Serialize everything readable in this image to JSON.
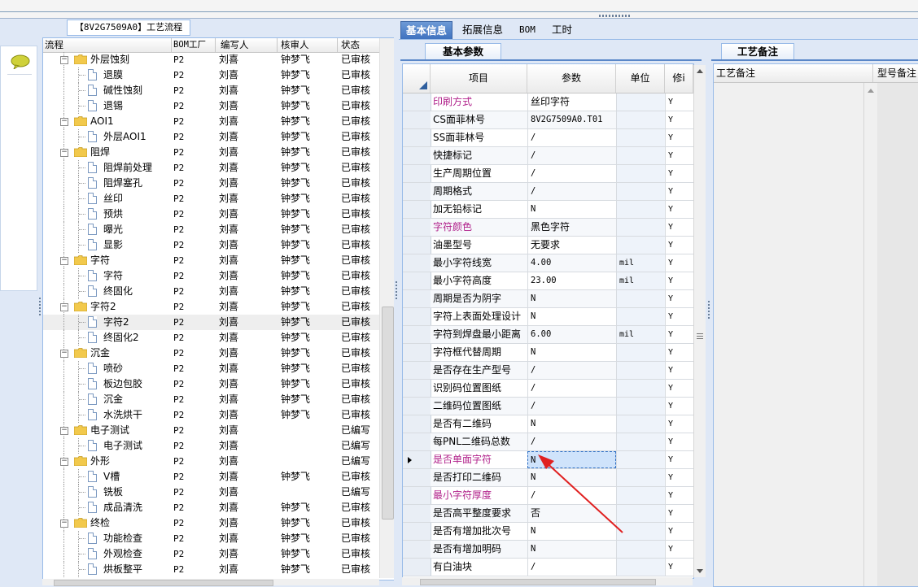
{
  "tree": {
    "title": "【8V2G7509A0】工艺流程",
    "headers": {
      "flow": "流程",
      "bom": "BOM工厂",
      "writer": "编写人",
      "auditor": "核审人",
      "status": "状态"
    },
    "rows": [
      {
        "level": 0,
        "label": "外层蚀刻",
        "bom": "P2",
        "writer": "刘喜",
        "auditor": "钟梦飞",
        "status": "已审核"
      },
      {
        "level": 1,
        "label": "退膜",
        "bom": "P2",
        "writer": "刘喜",
        "auditor": "钟梦飞",
        "status": "已审核"
      },
      {
        "level": 1,
        "label": "碱性蚀刻",
        "bom": "P2",
        "writer": "刘喜",
        "auditor": "钟梦飞",
        "status": "已审核"
      },
      {
        "level": 1,
        "label": "退锡",
        "bom": "P2",
        "writer": "刘喜",
        "auditor": "钟梦飞",
        "status": "已审核"
      },
      {
        "level": 0,
        "label": "AOI1",
        "bom": "P2",
        "writer": "刘喜",
        "auditor": "钟梦飞",
        "status": "已审核"
      },
      {
        "level": 1,
        "label": "外层AOI1",
        "bom": "P2",
        "writer": "刘喜",
        "auditor": "钟梦飞",
        "status": "已审核"
      },
      {
        "level": 0,
        "label": "阻焊",
        "bom": "P2",
        "writer": "刘喜",
        "auditor": "钟梦飞",
        "status": "已审核"
      },
      {
        "level": 1,
        "label": "阻焊前处理",
        "bom": "P2",
        "writer": "刘喜",
        "auditor": "钟梦飞",
        "status": "已审核"
      },
      {
        "level": 1,
        "label": "阻焊塞孔",
        "bom": "P2",
        "writer": "刘喜",
        "auditor": "钟梦飞",
        "status": "已审核"
      },
      {
        "level": 1,
        "label": "丝印",
        "bom": "P2",
        "writer": "刘喜",
        "auditor": "钟梦飞",
        "status": "已审核"
      },
      {
        "level": 1,
        "label": "预烘",
        "bom": "P2",
        "writer": "刘喜",
        "auditor": "钟梦飞",
        "status": "已审核"
      },
      {
        "level": 1,
        "label": "曝光",
        "bom": "P2",
        "writer": "刘喜",
        "auditor": "钟梦飞",
        "status": "已审核"
      },
      {
        "level": 1,
        "label": "显影",
        "bom": "P2",
        "writer": "刘喜",
        "auditor": "钟梦飞",
        "status": "已审核"
      },
      {
        "level": 0,
        "label": "字符",
        "bom": "P2",
        "writer": "刘喜",
        "auditor": "钟梦飞",
        "status": "已审核"
      },
      {
        "level": 1,
        "label": "字符",
        "bom": "P2",
        "writer": "刘喜",
        "auditor": "钟梦飞",
        "status": "已审核"
      },
      {
        "level": 1,
        "label": "终固化",
        "bom": "P2",
        "writer": "刘喜",
        "auditor": "钟梦飞",
        "status": "已审核"
      },
      {
        "level": 0,
        "label": "字符2",
        "bom": "P2",
        "writer": "刘喜",
        "auditor": "钟梦飞",
        "status": "已审核"
      },
      {
        "level": 1,
        "label": "字符2",
        "bom": "P2",
        "writer": "刘喜",
        "auditor": "钟梦飞",
        "status": "已审核",
        "selected": true
      },
      {
        "level": 1,
        "label": "终固化2",
        "bom": "P2",
        "writer": "刘喜",
        "auditor": "钟梦飞",
        "status": "已审核"
      },
      {
        "level": 0,
        "label": "沉金",
        "bom": "P2",
        "writer": "刘喜",
        "auditor": "钟梦飞",
        "status": "已审核"
      },
      {
        "level": 1,
        "label": "喷砂",
        "bom": "P2",
        "writer": "刘喜",
        "auditor": "钟梦飞",
        "status": "已审核"
      },
      {
        "level": 1,
        "label": "板边包胶",
        "bom": "P2",
        "writer": "刘喜",
        "auditor": "钟梦飞",
        "status": "已审核"
      },
      {
        "level": 1,
        "label": "沉金",
        "bom": "P2",
        "writer": "刘喜",
        "auditor": "钟梦飞",
        "status": "已审核"
      },
      {
        "level": 1,
        "label": "水洗烘干",
        "bom": "P2",
        "writer": "刘喜",
        "auditor": "钟梦飞",
        "status": "已审核"
      },
      {
        "level": 0,
        "label": "电子测试",
        "bom": "P2",
        "writer": "刘喜",
        "auditor": "",
        "status": "已编写"
      },
      {
        "level": 1,
        "label": "电子测试",
        "bom": "P2",
        "writer": "刘喜",
        "auditor": "",
        "status": "已编写"
      },
      {
        "level": 0,
        "label": "外形",
        "bom": "P2",
        "writer": "刘喜",
        "auditor": "",
        "status": "已编写"
      },
      {
        "level": 1,
        "label": "V槽",
        "bom": "P2",
        "writer": "刘喜",
        "auditor": "钟梦飞",
        "status": "已审核"
      },
      {
        "level": 1,
        "label": "铣板",
        "bom": "P2",
        "writer": "刘喜",
        "auditor": "",
        "status": "已编写"
      },
      {
        "level": 1,
        "label": "成品清洗",
        "bom": "P2",
        "writer": "刘喜",
        "auditor": "钟梦飞",
        "status": "已审核"
      },
      {
        "level": 0,
        "label": "终检",
        "bom": "P2",
        "writer": "刘喜",
        "auditor": "钟梦飞",
        "status": "已审核"
      },
      {
        "level": 1,
        "label": "功能检查",
        "bom": "P2",
        "writer": "刘喜",
        "auditor": "钟梦飞",
        "status": "已审核"
      },
      {
        "level": 1,
        "label": "外观检查",
        "bom": "P2",
        "writer": "刘喜",
        "auditor": "钟梦飞",
        "status": "已审核"
      },
      {
        "level": 1,
        "label": "烘板整平",
        "bom": "P2",
        "writer": "刘喜",
        "auditor": "钟梦飞",
        "status": "已审核"
      }
    ]
  },
  "tabs": [
    "基本信息",
    "拓展信息",
    "BOM",
    "工时"
  ],
  "params": {
    "tab_label": "基本参数",
    "headers": {
      "item": "项目",
      "param": "参数",
      "unit": "单位",
      "mod": "修i"
    },
    "rows": [
      {
        "item": "印刷方式",
        "param": "丝印字符",
        "unit": "",
        "mod": "Y",
        "pink": true
      },
      {
        "item": "CS面菲林号",
        "param": "8V2G7509A0.T01",
        "unit": "",
        "mod": "Y"
      },
      {
        "item": "SS面菲林号",
        "param": "/",
        "unit": "",
        "mod": "Y"
      },
      {
        "item": "快捷标记",
        "param": "/",
        "unit": "",
        "mod": "Y"
      },
      {
        "item": "生产周期位置",
        "param": "/",
        "unit": "",
        "mod": "Y"
      },
      {
        "item": "周期格式",
        "param": "/",
        "unit": "",
        "mod": "Y"
      },
      {
        "item": "加无铅标记",
        "param": "N",
        "unit": "",
        "mod": "Y"
      },
      {
        "item": "字符颜色",
        "param": "黑色字符",
        "unit": "",
        "mod": "Y",
        "pink": true
      },
      {
        "item": "油墨型号",
        "param": "无要求",
        "unit": "",
        "mod": "Y"
      },
      {
        "item": "最小字符线宽",
        "param": "4.00",
        "unit": "mil",
        "mod": "Y"
      },
      {
        "item": "最小字符高度",
        "param": "23.00",
        "unit": "mil",
        "mod": "Y"
      },
      {
        "item": "周期是否为阴字",
        "param": "N",
        "unit": "",
        "mod": "Y"
      },
      {
        "item": "字符上表面处理设计",
        "param": "N",
        "unit": "",
        "mod": "Y"
      },
      {
        "item": "字符到焊盘最小距离",
        "param": "6.00",
        "unit": "mil",
        "mod": "Y"
      },
      {
        "item": "字符框代替周期",
        "param": "N",
        "unit": "",
        "mod": "Y"
      },
      {
        "item": "是否存在生产型号",
        "param": "/",
        "unit": "",
        "mod": "Y"
      },
      {
        "item": "识别码位置图纸",
        "param": "/",
        "unit": "",
        "mod": "Y"
      },
      {
        "item": "二维码位置图纸",
        "param": "/",
        "unit": "",
        "mod": "Y"
      },
      {
        "item": "是否有二维码",
        "param": "N",
        "unit": "",
        "mod": "Y"
      },
      {
        "item": "每PNL二维码总数",
        "param": "/",
        "unit": "",
        "mod": "Y"
      },
      {
        "item": "是否单面字符",
        "param": "N",
        "unit": "",
        "mod": "Y",
        "pink": true,
        "current": true
      },
      {
        "item": "是否打印二维码",
        "param": "N",
        "unit": "",
        "mod": "Y"
      },
      {
        "item": "最小字符厚度",
        "param": "/",
        "unit": "",
        "mod": "Y",
        "pink": true
      },
      {
        "item": "是否高平整度要求",
        "param": "否",
        "unit": "",
        "mod": "Y"
      },
      {
        "item": "是否有增加批次号",
        "param": "N",
        "unit": "",
        "mod": "Y"
      },
      {
        "item": "是否有增加明码",
        "param": "N",
        "unit": "",
        "mod": "Y"
      },
      {
        "item": "有白油块",
        "param": "/",
        "unit": "",
        "mod": "Y"
      }
    ]
  },
  "notes": {
    "tab_label": "工艺备注",
    "headers": {
      "note": "工艺备注",
      "model_note": "型号备注"
    }
  },
  "colors": {
    "accent": "#3f72bf",
    "pink_text": "#b0208a",
    "arrow": "#e02020"
  }
}
